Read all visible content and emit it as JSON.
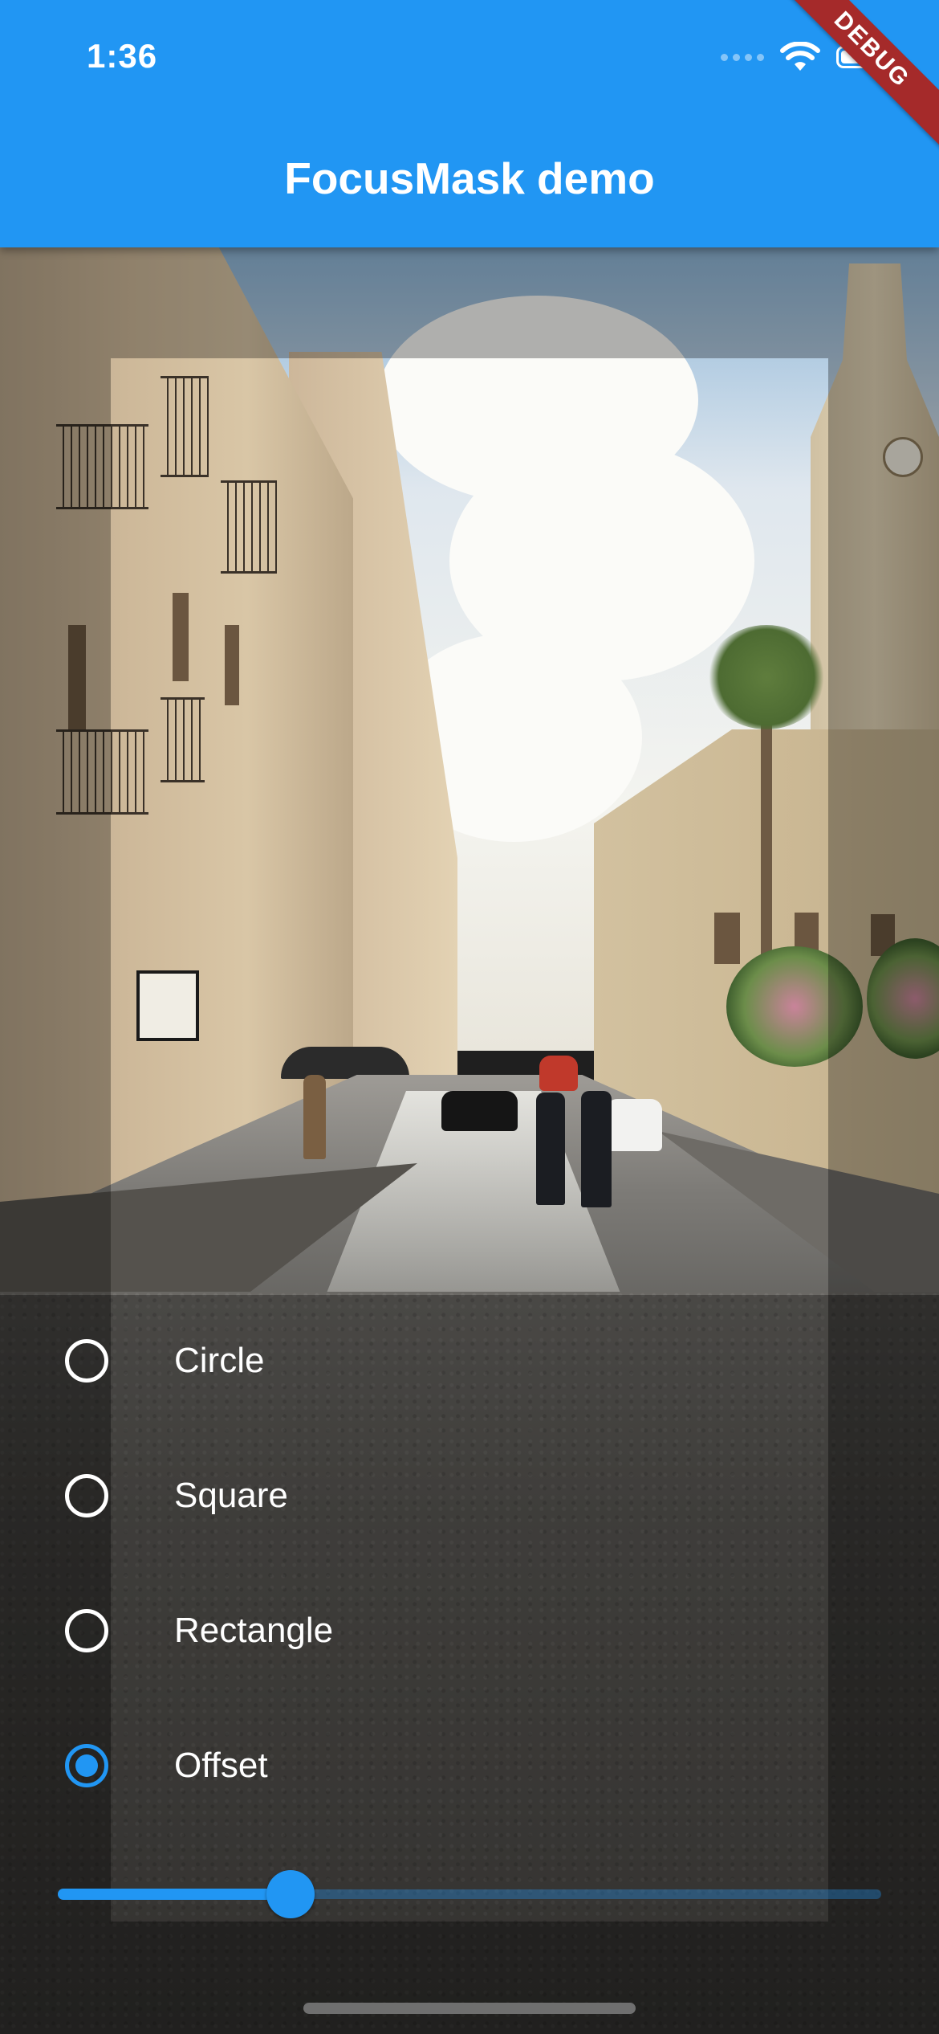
{
  "status_bar": {
    "time": "1:36"
  },
  "app_bar": {
    "title": "FocusMask demo",
    "color": "#2196F3"
  },
  "debug_banner": {
    "label": "DEBUG",
    "color": "#A52A2A"
  },
  "shape_options": [
    {
      "label": "Circle",
      "selected": false
    },
    {
      "label": "Square",
      "selected": false
    },
    {
      "label": "Rectangle",
      "selected": false
    },
    {
      "label": "Offset",
      "selected": true
    }
  ],
  "offset_slider": {
    "value_fraction": 0.283,
    "accent": "#2196F3"
  },
  "icons": {
    "wifi": "wifi-icon",
    "battery": "battery-icon",
    "cellular": "cellular-dots-icon"
  }
}
